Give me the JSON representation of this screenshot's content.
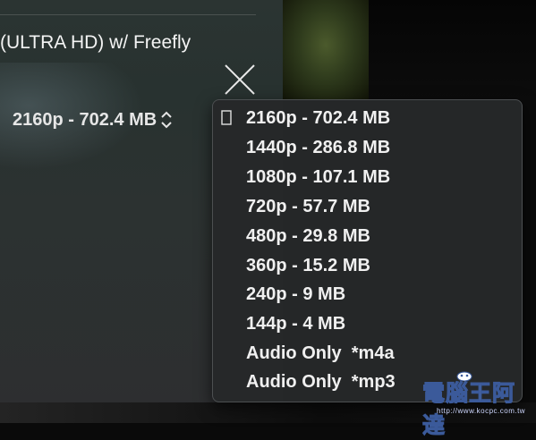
{
  "dialog": {
    "title": "(ULTRA HD) w/ Freefly",
    "selected_quality": "2160p - 702.4 MB"
  },
  "menu": {
    "items": [
      {
        "label": "2160p - 702.4 MB",
        "selected": true
      },
      {
        "label": "1440p - 286.8 MB"
      },
      {
        "label": "1080p - 107.1 MB"
      },
      {
        "label": "720p - 57.7 MB"
      },
      {
        "label": "480p - 29.8 MB"
      },
      {
        "label": "360p - 15.2 MB"
      },
      {
        "label": "240p - 9 MB"
      },
      {
        "label": "144p - 4 MB"
      },
      {
        "label": "Audio Only  *m4a"
      },
      {
        "label": "Audio Only  *mp3"
      }
    ]
  },
  "watermark": {
    "text": "電腦王阿達",
    "url": "http://www.kocpc.com.tw"
  },
  "icons": {
    "close": "close-x-icon",
    "stepper": "up-down-chevron-icon",
    "check": "check-icon",
    "mascot": "mascot-icon"
  },
  "colors": {
    "menu_background": "#262829",
    "text": "#f0f0f0",
    "dialog_background": "#2b3432"
  }
}
